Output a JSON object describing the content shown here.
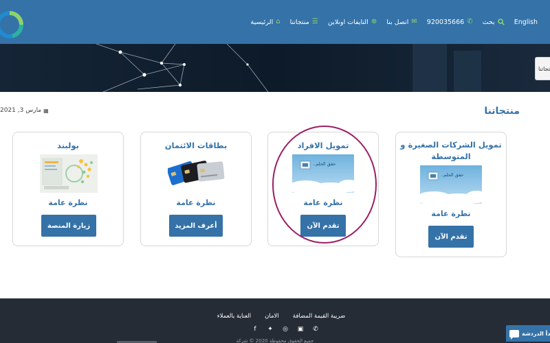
{
  "nav": {
    "home": "الرئيسية",
    "products": "منتجاتنا",
    "apps_online": "التايفات اونلاين",
    "contact": "اتصل بنا",
    "phone": "920035666",
    "search": "بحث",
    "language": "English"
  },
  "side_tab": "منتجاتنا",
  "section_title": "منتجاتنا",
  "date": "مارس 3, 2021",
  "thumb_text": "حقق الحلم..",
  "cards": [
    {
      "title": "بولبند",
      "subtitle": "نظرة عامة",
      "button": "زيارة المنصة"
    },
    {
      "title": "بطاقات الائتمان",
      "subtitle": "نظرة عامة",
      "button": "أعرف المزيد"
    },
    {
      "title": "تمويل الافراد",
      "subtitle": "نظرة عامة",
      "button": "تقدم الآن"
    },
    {
      "title": "تمويل الشركات الصغيرة و المتوسطة",
      "subtitle": "نظرة عامة",
      "button": "تقدم الآن"
    }
  ],
  "footer": {
    "links": [
      "ضريبة القيمة المضافة",
      "الامان",
      "العناية بالعملاء"
    ],
    "social_icons": [
      "facebook-icon",
      "twitter-icon",
      "instagram-icon",
      "linkedin-icon",
      "whatsapp-icon"
    ],
    "copyright": "جميع الحقوق محفوظة 2020 © شركة"
  },
  "chat": {
    "label": "لنبدأ الدردشة"
  },
  "colors": {
    "primary": "#3472a8",
    "accent_green": "#8fd36b",
    "footer_bg": "#262c36",
    "highlight": "#9a1d61"
  }
}
